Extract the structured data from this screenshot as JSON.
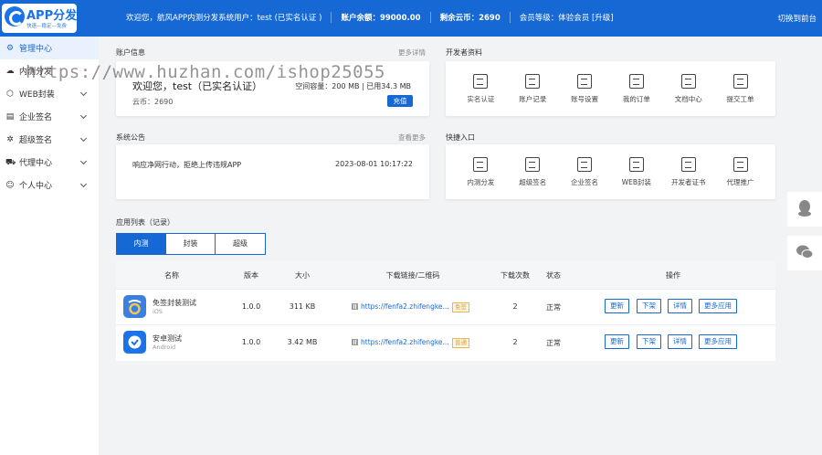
{
  "header": {
    "logo_title": "APP分发",
    "logo_sub": "快速—稳定—免费",
    "welcome": "欢迎您，航风APP内测分发系统用户：test (已实名认证 )",
    "balance": "账户余额：99000.00",
    "coins": "剩余云币：2690",
    "level": "会员等级：体验会员 [升级]",
    "switch": "切换到前台"
  },
  "sidebar": {
    "items": [
      {
        "label": "管理中心",
        "icon": "gear-icon"
      },
      {
        "label": "内测分发",
        "icon": "cloud-icon"
      },
      {
        "label": "WEB封装",
        "icon": "box-icon"
      },
      {
        "label": "企业签名",
        "icon": "doc-icon"
      },
      {
        "label": "超级签名",
        "icon": "star-icon"
      },
      {
        "label": "代理中心",
        "icon": "cart-icon"
      },
      {
        "label": "个人中心",
        "icon": "user-icon"
      }
    ]
  },
  "account": {
    "title": "账户信息",
    "more": "更多详情",
    "welcome": "欢迎您，test（已实名认证）",
    "coins": "云币：2690",
    "space": "空间容量：200 MB | 已用34.3 MB",
    "charge": "充值"
  },
  "developer": {
    "title": "开发者资料",
    "items": [
      {
        "label": "实名认证"
      },
      {
        "label": "账户记录"
      },
      {
        "label": "账号设置"
      },
      {
        "label": "我的订单"
      },
      {
        "label": "文档中心"
      },
      {
        "label": "提交工单"
      }
    ]
  },
  "notice": {
    "title": "系统公告",
    "more": "查看更多",
    "text": "响应净网行动，拒绝上传违规APP",
    "date": "2023-08-01 10:17:22"
  },
  "quick": {
    "title": "快捷入口",
    "items": [
      {
        "label": "内测分发"
      },
      {
        "label": "超级签名"
      },
      {
        "label": "企业签名"
      },
      {
        "label": "WEB封装"
      },
      {
        "label": "开发者证书"
      },
      {
        "label": "代理推广"
      }
    ]
  },
  "apps": {
    "title": "应用列表（记录）",
    "tabs": [
      "内测",
      "封装",
      "超级"
    ],
    "columns": [
      "名称",
      "版本",
      "大小",
      "下载链接/二维码",
      "下载次数",
      "状态",
      "操作"
    ],
    "rows": [
      {
        "name": "免签封装测试",
        "os": "iOS",
        "version": "1.0.0",
        "size": "311 KB",
        "link": "https://fenfa2.zhifengke...",
        "tag": "免签",
        "downloads": "2",
        "status": "正常"
      },
      {
        "name": "安卓测试",
        "os": "Android",
        "version": "1.0.0",
        "size": "3.42 MB",
        "link": "https://fenfa2.zhifengke...",
        "tag": "普通",
        "downloads": "2",
        "status": "正常"
      }
    ],
    "ops": [
      "更新",
      "下架",
      "详情",
      "更多应用"
    ]
  },
  "watermark": "https://www.huzhan.com/ishop25055",
  "colors": {
    "primary": "#1668d4",
    "background": "#f2f3f5"
  }
}
